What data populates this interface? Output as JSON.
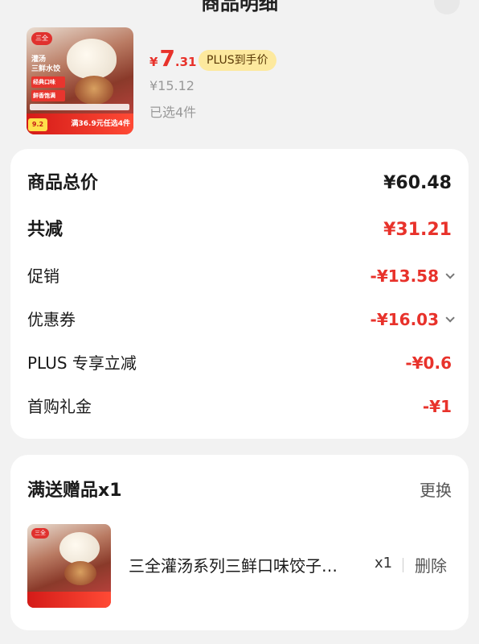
{
  "header": {
    "title": "商品明细"
  },
  "product": {
    "thumb_text": {
      "logo": "三全",
      "line1": "灌汤",
      "line2": "三鲜水饺",
      "tag1": "经典口味",
      "tag2": "鲜香饱满",
      "badge": "9.2",
      "promo": "满36.9元任选4件"
    },
    "price_symbol": "¥",
    "price_int": "7",
    "price_dec": ".31",
    "plus_label": "PLUS到手价",
    "original_price": "¥15.12",
    "selected_count": "已选4件"
  },
  "breakdown": {
    "rows": [
      {
        "label": "商品总价",
        "value": "¥60.48",
        "bold": true,
        "red": false,
        "expandable": false
      },
      {
        "label": "共减",
        "value": "¥31.21",
        "bold": true,
        "red": true,
        "expandable": false
      },
      {
        "label": "促销",
        "value": "-¥13.58",
        "bold": false,
        "red": true,
        "expandable": true
      },
      {
        "label": "优惠券",
        "value": "-¥16.03",
        "bold": false,
        "red": true,
        "expandable": true
      },
      {
        "label": "PLUS 专享立减",
        "value": "-¥0.6",
        "bold": false,
        "red": true,
        "expandable": false
      },
      {
        "label": "首购礼金",
        "value": "-¥1",
        "bold": false,
        "red": true,
        "expandable": false
      }
    ]
  },
  "gift": {
    "title": "满送赠品x1",
    "change_label": "更换",
    "thumb_logo": "三全",
    "name": "三全灌汤系列三鲜口味饺子…",
    "qty": "x1",
    "delete_label": "删除"
  },
  "colors": {
    "accent_red": "#e8322b",
    "plus_badge_bg": "#fde99e",
    "page_bg": "#f2f2f2"
  }
}
